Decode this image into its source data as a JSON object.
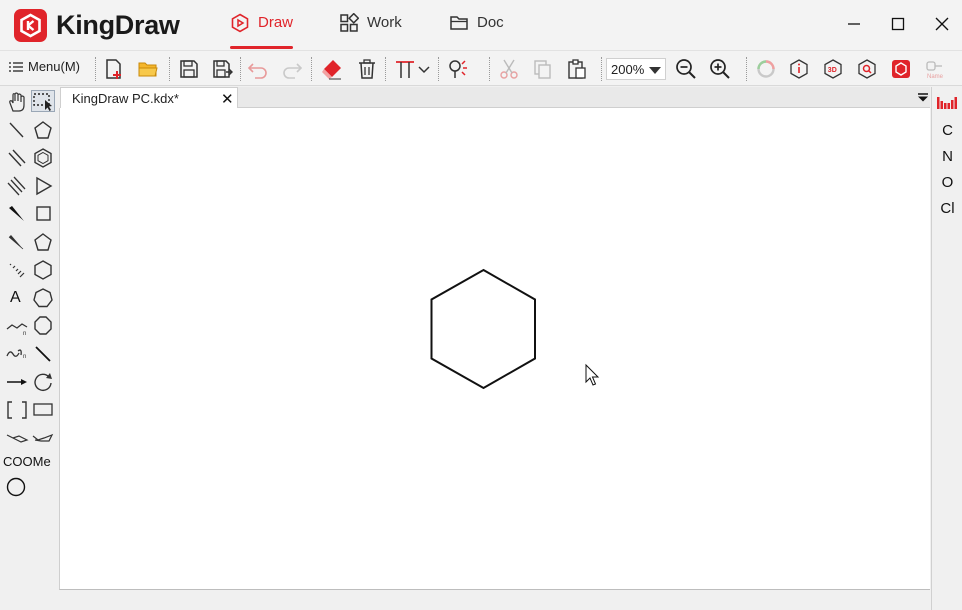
{
  "app": {
    "name": "KingDraw"
  },
  "nav": {
    "tabs": [
      {
        "label": "Draw",
        "icon": "draw-icon",
        "active": true
      },
      {
        "label": "Work",
        "icon": "grid-icon",
        "active": false
      },
      {
        "label": "Doc",
        "icon": "folder-icon",
        "active": false
      }
    ]
  },
  "toolbar": {
    "menu_label": "Menu(M)",
    "zoom": "200%",
    "icons": [
      "new-doc-icon",
      "open-folder-icon",
      "save-icon",
      "save-as-icon",
      "undo-icon",
      "redo-icon",
      "eraser-icon",
      "delete-icon",
      "text-format-icon",
      "clean-structure-icon",
      "cut-icon",
      "copy-icon",
      "paste-icon",
      "zoom-out-icon",
      "zoom-in-icon",
      "color-ring-icon",
      "info-icon",
      "3d-icon",
      "query-icon",
      "recognize-icon",
      "name-icon"
    ]
  },
  "left_tools": {
    "text_tool": "A",
    "group_label": "COOMe"
  },
  "document": {
    "tab_label": "KingDraw PC.kdx*",
    "close_symbol": "✕"
  },
  "elements": [
    "C",
    "N",
    "O",
    "Cl"
  ],
  "colors": {
    "accent": "#e0242a",
    "selected": "#dfe4ea"
  }
}
